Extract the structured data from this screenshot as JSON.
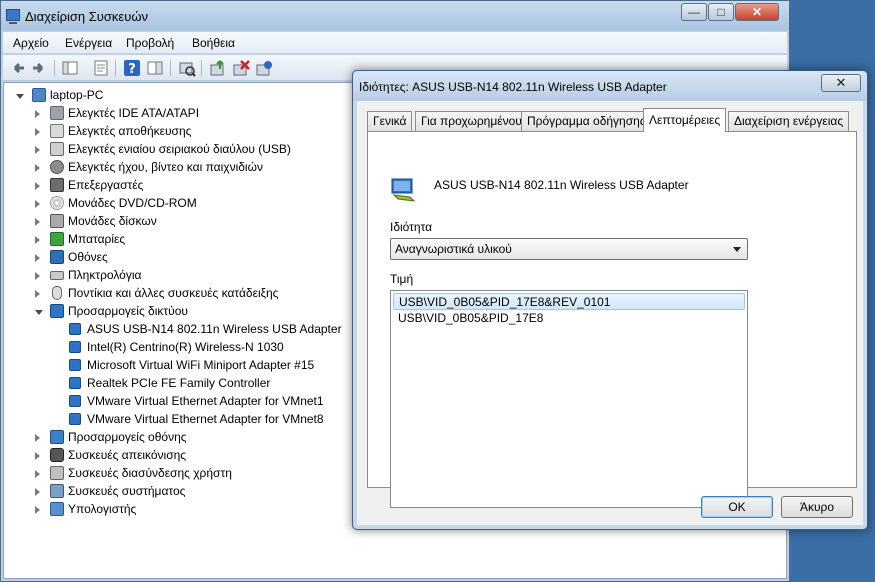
{
  "main_window": {
    "title": "Διαχείριση Συσκευών",
    "controls": {
      "minimize": "—",
      "maximize": "□",
      "close": "✕"
    }
  },
  "menu": [
    "Αρχείο",
    "Ενέργεια",
    "Προβολή",
    "Βοήθεια"
  ],
  "toolbar_icons": [
    "back-arrow-icon",
    "forward-arrow-icon",
    "show-hide-tree-icon",
    "properties-icon",
    "help-icon",
    "action-pane-icon",
    "scan-hardware-icon",
    "update-driver-icon",
    "disable-device-icon",
    "uninstall-device-icon"
  ],
  "tree": {
    "root": "laptop-PC",
    "categories": [
      {
        "label": "Ελεγκτές IDE ATA/ATAPI",
        "icon": "ide-controller-icon"
      },
      {
        "label": "Ελεγκτές αποθήκευσης",
        "icon": "storage-controller-icon"
      },
      {
        "label": "Ελεγκτές ενιαίου σειριακού διαύλου (USB)",
        "icon": "usb-icon"
      },
      {
        "label": "Ελεγκτές ήχου, βίντεο και παιχνιδιών",
        "icon": "sound-icon"
      },
      {
        "label": "Επεξεργαστές",
        "icon": "processor-icon"
      },
      {
        "label": "Μονάδες DVD/CD-ROM",
        "icon": "dvd-icon"
      },
      {
        "label": "Μονάδες δίσκων",
        "icon": "disk-drive-icon"
      },
      {
        "label": "Μπαταρίες",
        "icon": "battery-icon"
      },
      {
        "label": "Οθόνες",
        "icon": "monitor-icon"
      },
      {
        "label": "Πληκτρολόγια",
        "icon": "keyboard-icon"
      },
      {
        "label": "Ποντίκια και άλλες συσκευές κατάδειξης",
        "icon": "mouse-icon"
      },
      {
        "label": "Προσαρμογείς δικτύου",
        "icon": "network-adapter-icon"
      }
    ],
    "network_children": [
      "ASUS USB-N14 802.11n Wireless USB Adapter",
      "Intel(R) Centrino(R) Wireless-N 1030",
      "Microsoft Virtual WiFi Miniport Adapter #15",
      "Realtek PCIe FE Family Controller",
      "VMware Virtual Ethernet Adapter for VMnet1",
      "VMware Virtual Ethernet Adapter for VMnet8"
    ],
    "categories_after": [
      {
        "label": "Προσαρμογείς οθόνης",
        "icon": "display-adapter-icon"
      },
      {
        "label": "Συσκευές απεικόνισης",
        "icon": "imaging-device-icon"
      },
      {
        "label": "Συσκευές διασύνδεσης χρήστη",
        "icon": "hid-icon"
      },
      {
        "label": "Συσκευές συστήματος",
        "icon": "system-device-icon"
      },
      {
        "label": "Υπολογιστής",
        "icon": "computer-icon"
      }
    ]
  },
  "dialog": {
    "title": "Ιδιότητες: ASUS USB-N14 802.11n Wireless USB Adapter",
    "close": "✕",
    "tabs": [
      "Γενικά",
      "Για προχωρημένους",
      "Πρόγραμμα οδήγησης",
      "Λεπτομέρειες",
      "Διαχείριση ενέργειας"
    ],
    "active_tab": "Λεπτομέρειες",
    "device_name": "ASUS USB-N14 802.11n Wireless USB Adapter",
    "property_label": "Ιδιότητα",
    "property_value": "Αναγνωριστικά υλικού",
    "value_label": "Τιμή",
    "values": [
      "USB\\VID_0B05&PID_17E8&REV_0101",
      "USB\\VID_0B05&PID_17E8"
    ],
    "ok": "OK",
    "cancel": "Άκυρο"
  }
}
